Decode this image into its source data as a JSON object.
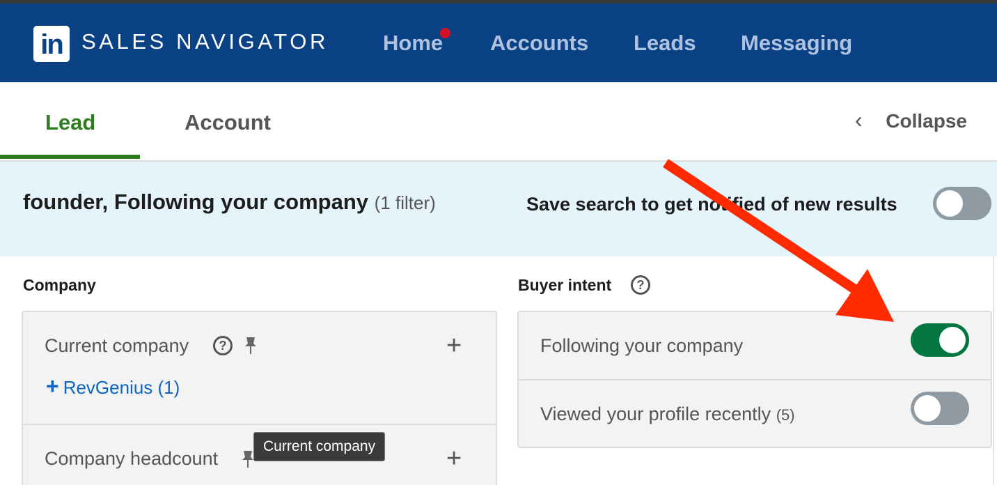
{
  "header": {
    "logo_text": "in",
    "brand": "SALES NAVIGATOR",
    "nav": [
      "Home",
      "Accounts",
      "Leads",
      "Messaging"
    ]
  },
  "tabs": {
    "lead": "Lead",
    "account": "Account",
    "collapse": "Collapse",
    "collapse_icon": "chevron-left-icon"
  },
  "banner": {
    "query": "founder, Following your company",
    "filter_count": "(1 filter)",
    "save_text": "Save search to get notified of new results",
    "save_toggle_on": false
  },
  "company": {
    "title": "Company",
    "current_company": {
      "label": "Current company",
      "selected": "RevGenius (1)"
    },
    "headcount": {
      "label": "Company headcount"
    },
    "tooltip": "Current company"
  },
  "buyer_intent": {
    "title": "Buyer intent",
    "items": [
      {
        "label": "Following your company",
        "count": "",
        "on": true
      },
      {
        "label": "Viewed your profile recently",
        "count": "(5)",
        "on": false
      }
    ]
  },
  "colors": {
    "header_bg": "#0a4185",
    "accent_green": "#057642",
    "tab_green": "#2e7d1e",
    "link_blue": "#0a66c2",
    "notification": "#d11124",
    "annotation_arrow": "#ff2a00"
  }
}
